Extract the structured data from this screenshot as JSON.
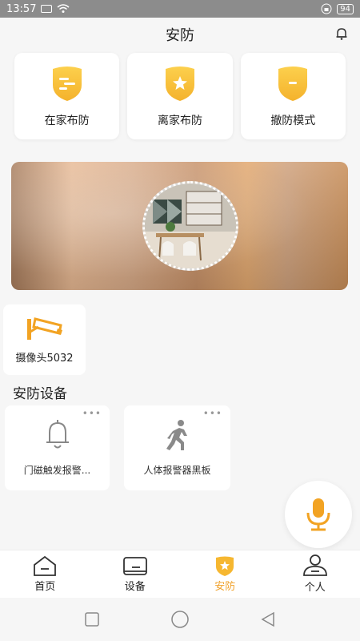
{
  "status_bar": {
    "time": "13:57",
    "battery": "94"
  },
  "header": {
    "title": "安防"
  },
  "modes": [
    {
      "label": "在家布防",
      "icon": "home-arm-shield-icon"
    },
    {
      "label": "离家布防",
      "icon": "away-arm-shield-icon"
    },
    {
      "label": "撤防模式",
      "icon": "disarm-shield-icon"
    }
  ],
  "camera": {
    "label": "摄像头5032",
    "icon": "camera-icon"
  },
  "security_section": {
    "title": "安防设备",
    "devices": [
      {
        "label": "门磁触发报警...",
        "icon": "bell-icon"
      },
      {
        "label": "人体报警器黑板",
        "icon": "walking-person-icon"
      }
    ]
  },
  "tabbar": {
    "tabs": [
      {
        "label": "首页",
        "icon": "home-icon",
        "active": false
      },
      {
        "label": "设备",
        "icon": "device-icon",
        "active": false
      },
      {
        "label": "安防",
        "icon": "shield-icon",
        "active": true
      },
      {
        "label": "个人",
        "icon": "person-icon",
        "active": false
      }
    ]
  },
  "colors": {
    "accent": "#f0a12a",
    "shield": "#f8c23e"
  }
}
